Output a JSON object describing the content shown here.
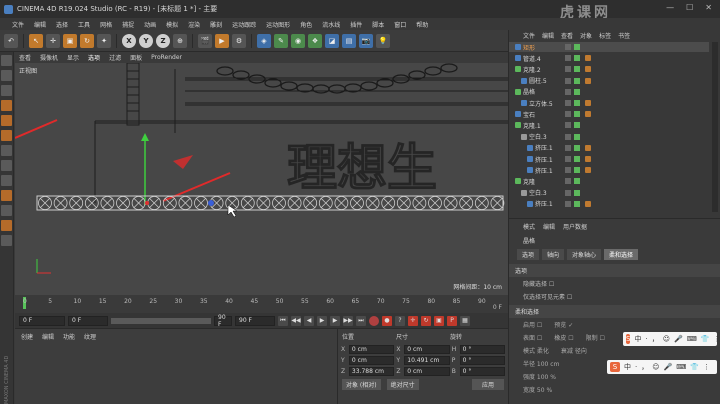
{
  "window": {
    "title": "CINEMA 4D R19.024 Studio (RC - R19) - [未标题 1 *] - 主要",
    "controls": [
      "—",
      "☐",
      "✕"
    ]
  },
  "watermark": "虎课网",
  "menubar": [
    "文件",
    "编辑",
    "选择",
    "工具",
    "网格",
    "捕捉",
    "动画",
    "模拟",
    "渲染",
    "雕刻",
    "运动跟踪",
    "运动图形",
    "角色",
    "流水线",
    "插件",
    "脚本",
    "窗口",
    "帮助"
  ],
  "toolbar": {
    "undo": "↶",
    "axes": [
      "X",
      "Y",
      "Z"
    ]
  },
  "viewport": {
    "menu": [
      "查看",
      "摄像机",
      "显示",
      "选项",
      "过滤",
      "面板",
      "ProRender"
    ],
    "active_menu": "选项",
    "label": "正视图",
    "grid_info": "网格间距：10 cm",
    "bg_text": "理想生"
  },
  "timeline": {
    "ticks": [
      "0",
      "5",
      "10",
      "15",
      "20",
      "25",
      "30",
      "35",
      "40",
      "45",
      "50",
      "55",
      "60",
      "65",
      "70",
      "75",
      "80",
      "85",
      "90"
    ],
    "end_label": "0 F"
  },
  "transport": {
    "start": "0 F",
    "current": "0 F",
    "mid": "90 F",
    "end": "90 F"
  },
  "material": {
    "menu": [
      "创建",
      "编辑",
      "功能",
      "纹理"
    ],
    "brand": "MAXON CINEMA 4D"
  },
  "coords": {
    "headers": [
      "位置",
      "尺寸",
      "旋转"
    ],
    "rows": [
      {
        "axis": "X",
        "pos": "0 cm",
        "size": "0 cm",
        "raxis": "H",
        "rot": "0 °"
      },
      {
        "axis": "Y",
        "pos": "0 cm",
        "size": "10.491 cm",
        "raxis": "P",
        "rot": "0 °"
      },
      {
        "axis": "Z",
        "pos": "33.788 cm",
        "size": "0 cm",
        "raxis": "B",
        "rot": "0 °"
      }
    ],
    "mode": "对象 (相对)",
    "size_mode": "绝对尺寸",
    "apply": "应用"
  },
  "object_manager": {
    "menu": [
      "文件",
      "编辑",
      "查看",
      "对象",
      "标签",
      "书签"
    ],
    "rows": [
      {
        "name": "矩形",
        "hl": true,
        "sel": true,
        "indent": 1,
        "color": "#4a7fc0",
        "tags": 0
      },
      {
        "name": "管道.4",
        "hl": false,
        "sel": false,
        "indent": 1,
        "color": "#4a7fc0",
        "tags": 1
      },
      {
        "name": "克隆.2",
        "hl": false,
        "sel": false,
        "indent": 1,
        "color": "#5cb85c",
        "tags": 1
      },
      {
        "name": "圆柱.5",
        "hl": false,
        "sel": false,
        "indent": 2,
        "color": "#4a7fc0",
        "tags": 1
      },
      {
        "name": "晶格",
        "hl": false,
        "sel": false,
        "indent": 1,
        "color": "#5cb85c",
        "tags": 0
      },
      {
        "name": "立方体.5",
        "hl": false,
        "sel": false,
        "indent": 2,
        "color": "#4a7fc0",
        "tags": 1
      },
      {
        "name": "宝石",
        "hl": false,
        "sel": false,
        "indent": 1,
        "color": "#4a7fc0",
        "tags": 1
      },
      {
        "name": "克隆.1",
        "hl": false,
        "sel": false,
        "indent": 1,
        "color": "#5cb85c",
        "tags": 0
      },
      {
        "name": "空白.3",
        "hl": false,
        "sel": false,
        "indent": 2,
        "color": "#999999",
        "tags": 0
      },
      {
        "name": "挤压.1",
        "hl": false,
        "sel": false,
        "indent": 3,
        "color": "#4a7fc0",
        "tags": 1
      },
      {
        "name": "挤压.1",
        "hl": false,
        "sel": false,
        "indent": 3,
        "color": "#4a7fc0",
        "tags": 1
      },
      {
        "name": "挤压.1",
        "hl": false,
        "sel": false,
        "indent": 3,
        "color": "#4a7fc0",
        "tags": 1
      },
      {
        "name": "克隆",
        "hl": false,
        "sel": false,
        "indent": 1,
        "color": "#5cb85c",
        "tags": 0
      },
      {
        "name": "空白.3",
        "hl": false,
        "sel": false,
        "indent": 2,
        "color": "#999999",
        "tags": 0
      },
      {
        "name": "挤压.1",
        "hl": false,
        "sel": false,
        "indent": 3,
        "color": "#4a7fc0",
        "tags": 1
      }
    ]
  },
  "attributes": {
    "menu": [
      "模式",
      "编辑",
      "用户数据"
    ],
    "title": "晶格",
    "tabs": [
      "选项",
      "轴向",
      "对象轴心",
      "柔和选择"
    ],
    "active_tab": "柔和选择",
    "section1": "选项",
    "line1": "隐藏选择 ☐",
    "line2": "仅选择可见元素 ☐",
    "section2": "柔和选择",
    "grid": [
      [
        "启用 ☐",
        "预览 ✓"
      ],
      [
        "表面 ☐",
        "橡皮 ☐",
        "限制 ☐"
      ],
      [
        "模式 柔化",
        "衰减 径向"
      ],
      [
        "半径 100 cm"
      ],
      [
        "强度 100 %"
      ],
      [
        "宽度 50 %"
      ]
    ]
  },
  "ime": {
    "logo": "S",
    "items": [
      "中",
      "·",
      "，",
      "☺",
      "🎤",
      "⌨",
      "👕",
      "⋮"
    ]
  }
}
